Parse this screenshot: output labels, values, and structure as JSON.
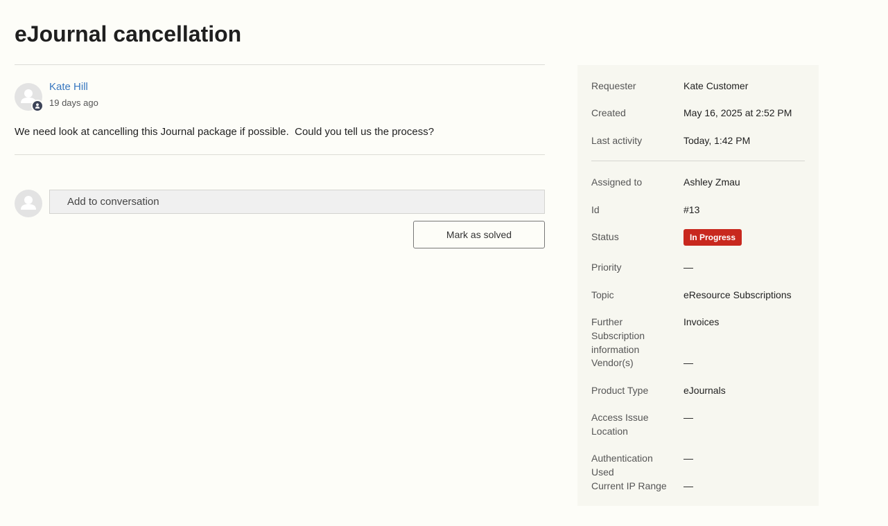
{
  "ticket": {
    "title": "eJournal cancellation"
  },
  "comment": {
    "author": "Kate Hill",
    "time": "19 days ago",
    "body": "We need look at cancelling this Journal package if possible.  Could you tell us the process?"
  },
  "reply": {
    "placeholder": "Add to conversation",
    "solve_label": "Mark as solved"
  },
  "details": {
    "requester": {
      "label": "Requester",
      "value": "Kate Customer"
    },
    "created": {
      "label": "Created",
      "value": "May 16, 2025 at 2:52 PM"
    },
    "last_activity": {
      "label": "Last activity",
      "value": "Today, 1:42 PM"
    },
    "assigned_to": {
      "label": "Assigned to",
      "value": "Ashley Zmau"
    },
    "id": {
      "label": "Id",
      "value": "#13"
    },
    "status": {
      "label": "Status",
      "value": "In Progress",
      "color": "#c8281e"
    },
    "priority": {
      "label": "Priority",
      "value": "—"
    },
    "topic": {
      "label": "Topic",
      "value": "eResource Subscriptions"
    },
    "further_info": {
      "label": "Further Subscription information",
      "value": "Invoices"
    },
    "vendors": {
      "label": "Vendor(s)",
      "value": "—"
    },
    "product_type": {
      "label": "Product Type",
      "value": "eJournals"
    },
    "access_issue_location": {
      "label": "Access Issue Location",
      "value": "—"
    },
    "authentication_used": {
      "label": "Authentication Used",
      "value": "—"
    },
    "current_ip_range": {
      "label": "Current IP Range",
      "value": "—"
    }
  },
  "icons": {
    "avatar": "person-icon",
    "agent_badge": "agent-badge-icon"
  }
}
